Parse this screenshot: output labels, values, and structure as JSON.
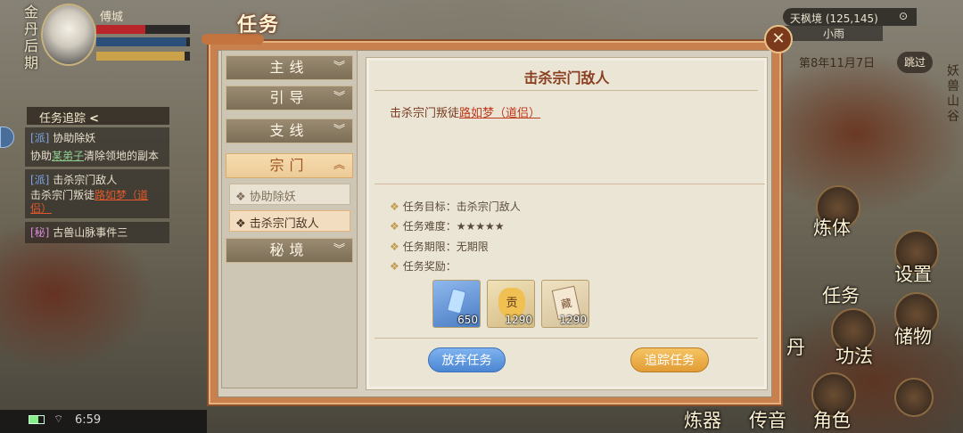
{
  "player": {
    "realm": "金丹后期",
    "name": "傅城"
  },
  "tracker": {
    "title": "任务追踪",
    "collapse_glyph": "<",
    "items": [
      {
        "tag": "[派]",
        "name": "协助除妖",
        "detail_pre": "协助",
        "detail_link": "某弟子",
        "detail_post": "清除领地的副本"
      },
      {
        "tag": "[派]",
        "name": "击杀宗门敌人",
        "detail_pre": "击杀宗门叛徒",
        "detail_link": "路如梦（道侣）"
      },
      {
        "tag": "[秘]",
        "name": "古兽山脉事件三"
      }
    ]
  },
  "location": {
    "name": "天枫境 (125,145)",
    "weather": "小雨"
  },
  "date": "第8年11月7日",
  "skip_label": "跳过",
  "side_area": "妖兽山谷",
  "right_menu": [
    "炼体",
    "设置",
    "任务",
    "储物",
    "丹",
    "功法",
    "炼器",
    "传音",
    "角色"
  ],
  "status_bar": {
    "time": "6:59"
  },
  "dialog": {
    "title": "任务",
    "close_glyph": "✕",
    "categories": [
      {
        "label": "主线",
        "chev": "︾"
      },
      {
        "label": "引导",
        "chev": "︾"
      },
      {
        "label": "支线",
        "chev": "︾"
      },
      {
        "label": "宗门",
        "chev": "︽"
      },
      {
        "label": "秘境",
        "chev": "︾"
      }
    ],
    "sub_items": [
      "❖ 协助除妖",
      "❖ 击杀宗门敌人"
    ],
    "quest": {
      "title": "击杀宗门敌人",
      "desc_pre": "击杀宗门叛徒",
      "desc_link": "路如梦（道侣）",
      "bullet": "❖",
      "objective_label": "任务目标：",
      "objective": "击杀宗门敌人",
      "difficulty_label": "任务难度：",
      "difficulty": "★★★★★",
      "deadline_label": "任务期限：",
      "deadline": "无期限",
      "reward_label": "任务奖励：",
      "rewards": [
        {
          "icon": "spirit-stone-icon",
          "count": "650",
          "color": "#5a8fd0"
        },
        {
          "icon": "contribution-bag-icon",
          "glyph": "贡",
          "count": "1290",
          "color": "#e9c77b"
        },
        {
          "icon": "scroll-icon",
          "glyph": "藏",
          "count": "1290",
          "color": "#e8d6b4"
        }
      ]
    },
    "abandon_label": "放弃任务",
    "track_label": "追踪任务"
  },
  "colors": {
    "dialog_frame": "#c9804f",
    "accent": "#a0531f",
    "abandon_btn": "#5b95dd",
    "track_btn": "#e6a443"
  }
}
